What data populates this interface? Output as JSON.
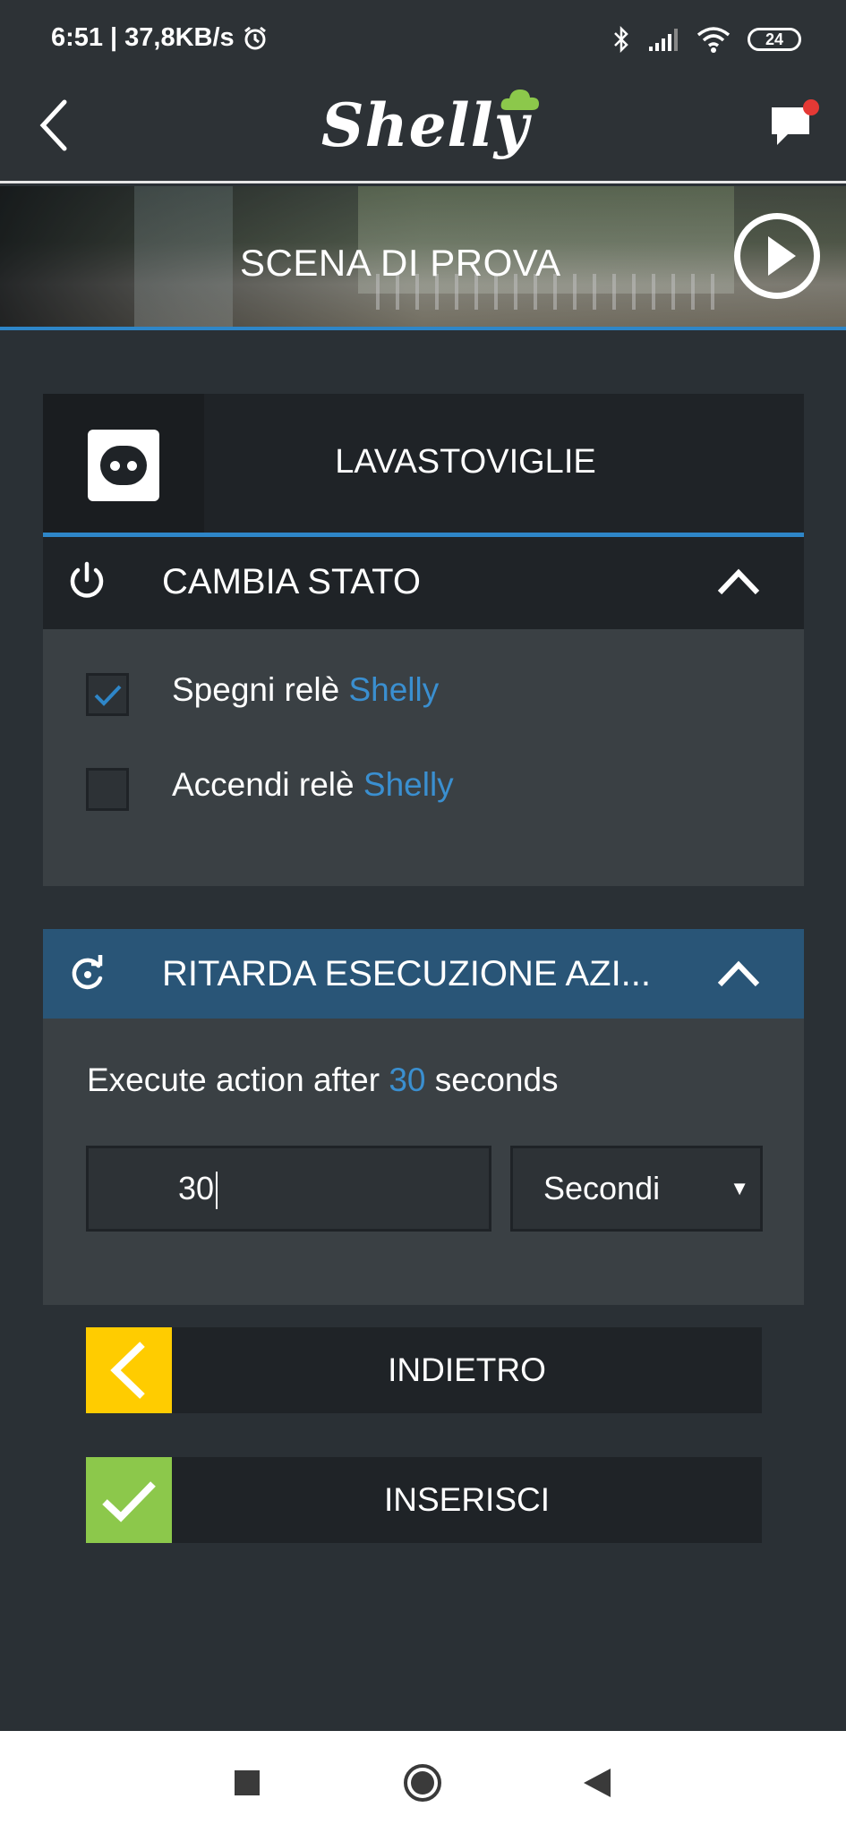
{
  "status_bar": {
    "time": "6:51",
    "network_speed": "37,8KB/s",
    "battery_level": "24",
    "icons": [
      "alarm-icon",
      "bluetooth-icon",
      "signal-icon",
      "wifi-icon",
      "battery-icon"
    ]
  },
  "app_bar": {
    "logo_text": "Shelly",
    "icons": [
      "back-arrow-icon",
      "chat-notification-icon"
    ]
  },
  "scene": {
    "title": "SCENA DI PROVA"
  },
  "device": {
    "name": "LAVASTOVIGLIE",
    "icon": "socket-icon"
  },
  "change_state": {
    "title": "CAMBIA STATO",
    "icon": "power-icon",
    "options": [
      {
        "label_prefix": "Spegni relè",
        "label_brand": "Shelly",
        "checked": true
      },
      {
        "label_prefix": "Accendi relè",
        "label_brand": "Shelly",
        "checked": false
      }
    ]
  },
  "delay": {
    "title": "RITARDA ESECUZIONE AZI...",
    "icon": "timer-refresh-icon",
    "text_prefix": "Execute action after",
    "text_value": "30",
    "text_suffix": "seconds",
    "input_value": "30",
    "unit_selected": "Secondi"
  },
  "buttons": {
    "back_label": "INDIETRO",
    "insert_label": "INSERISCI"
  },
  "colors": {
    "accent_blue": "#2e86c8",
    "brand_text": "#3a8fd0",
    "back_yellow": "#ffcc00",
    "insert_green": "#8cc84b",
    "delay_header": "#295577",
    "background": "#2a3035"
  }
}
